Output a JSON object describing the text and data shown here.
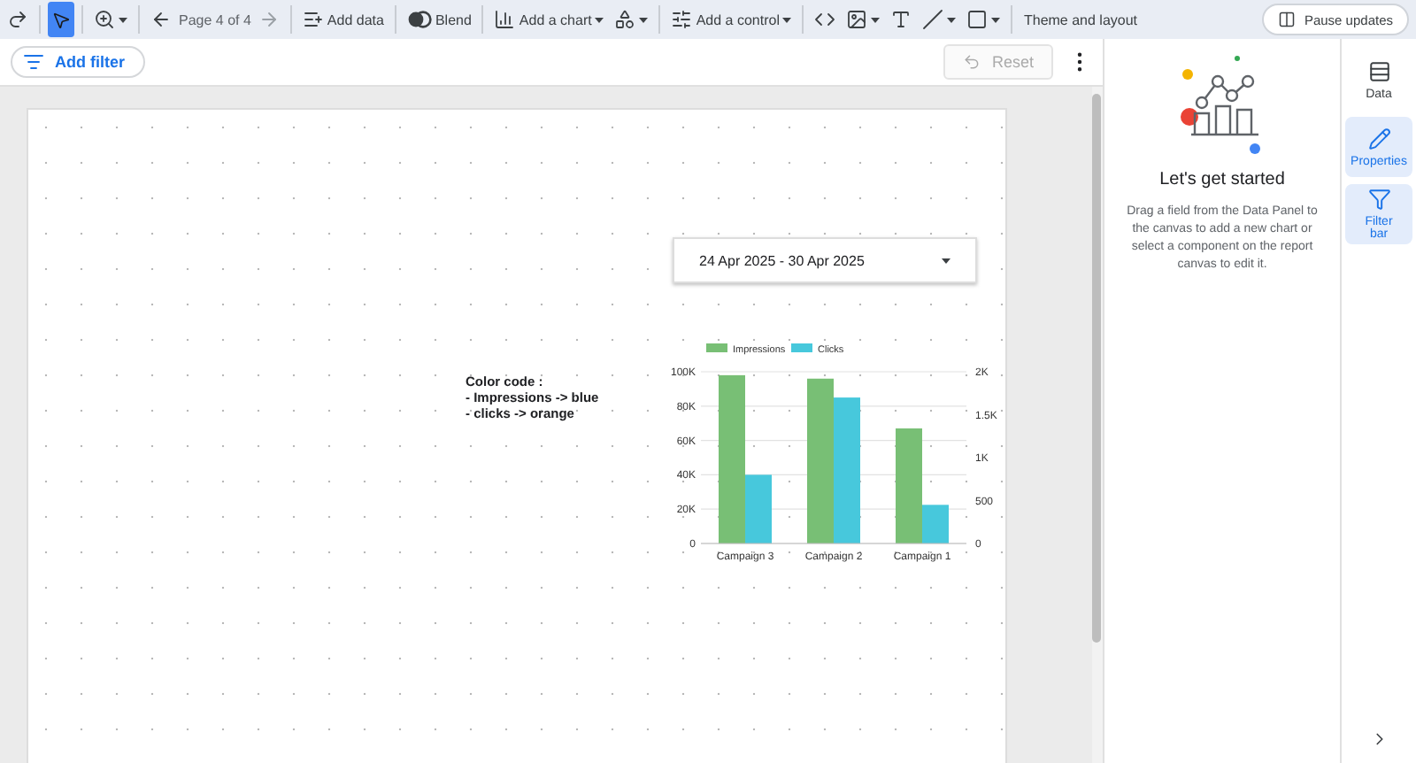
{
  "toolbar": {
    "select_tool": {
      "selected": true
    },
    "page_label": "Page 4 of 4",
    "next_page": {
      "disabled": true
    },
    "add_data": "Add data",
    "blend": "Blend",
    "add_chart": "Add a chart",
    "add_control": "Add a control",
    "theme": "Theme and layout",
    "pause": "Pause updates"
  },
  "filter_bar": {
    "add_filter": "Add filter",
    "reset": {
      "label": "Reset",
      "disabled": true
    }
  },
  "canvas": {
    "date_range": "24 Apr 2025 - 30 Apr 2025",
    "note": [
      "Color code :",
      "- Impressions -> blue",
      "- clicks -> orange"
    ],
    "chart": {
      "chart_data": {
        "type": "bar",
        "categories": [
          "Campaign 3",
          "Campaign 2",
          "Campaign 1"
        ],
        "series": [
          {
            "name": "Impressions",
            "color": "#78bf75",
            "values": [
              98000,
              96000,
              67000
            ]
          },
          {
            "name": "Clicks",
            "color": "#47c8dc",
            "axis": "y2",
            "values": [
              800,
              1700,
              450
            ]
          }
        ],
        "grid": true,
        "legend": "top",
        "ylim": [
          0,
          100000
        ],
        "yticks": [
          {
            "value": 0,
            "label": "0"
          },
          {
            "value": 20000,
            "label": "20K"
          },
          {
            "value": 40000,
            "label": "40K"
          },
          {
            "value": 60000,
            "label": "60K"
          },
          {
            "value": 80000,
            "label": "80K"
          },
          {
            "value": 100000,
            "label": "100K"
          }
        ],
        "y2ticks": [
          {
            "value": 0,
            "label": "0"
          },
          {
            "value": 500,
            "label": "500"
          },
          {
            "value": 1000,
            "label": "1K"
          },
          {
            "value": 1500,
            "label": "1.5K"
          },
          {
            "value": 2000,
            "label": "2K"
          }
        ],
        "y2lim": [
          0,
          2000
        ]
      }
    }
  },
  "panel": {
    "title": "Let's get started",
    "text": "Drag a field from the Data Panel to the canvas to add a new chart or select a component on the report canvas to edit it."
  },
  "rail": [
    {
      "label": "Data",
      "selected": false
    },
    {
      "label": "Properties",
      "selected": true
    },
    {
      "label": "Filter bar",
      "selected": true
    }
  ]
}
